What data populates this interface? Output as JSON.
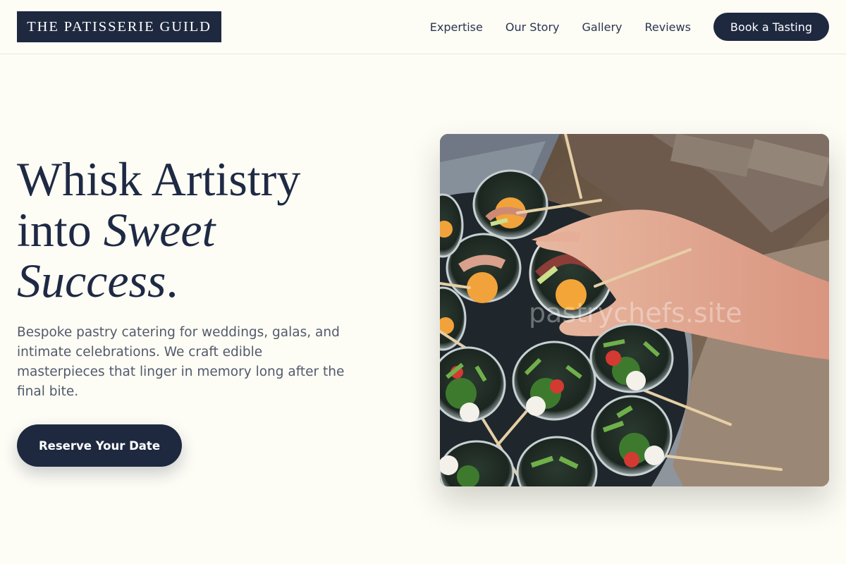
{
  "brand": {
    "name": "THE PATISSERIE GUILD"
  },
  "nav": {
    "links": [
      "Expertise",
      "Our Story",
      "Gallery",
      "Reviews"
    ],
    "cta_label": "Book a Tasting"
  },
  "hero": {
    "title_line1": "Whisk Artistry",
    "title_line2_plain": "into ",
    "title_line2_italic": "Sweet",
    "title_line3_italic": "Success",
    "title_line3_end": ".",
    "description": "Bespoke pastry catering for weddings, galas, and intimate celebrations. We craft edible masterpieces that linger in memory long after the final bite.",
    "cta_label": "Reserve Your Date",
    "image_watermark": "pastrychefs.site"
  },
  "colors": {
    "background": "#fdfcf5",
    "navy": "#1e2940",
    "body_text": "#525a6b"
  }
}
